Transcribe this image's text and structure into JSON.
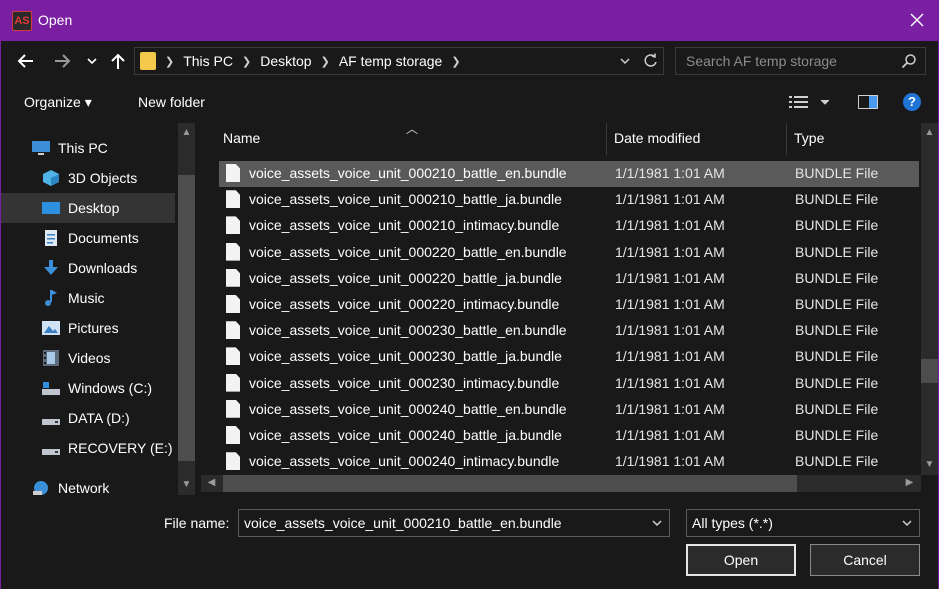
{
  "window": {
    "title": "Open",
    "app_icon_text": "AS"
  },
  "address": {
    "crumbs": [
      "This PC",
      "Desktop",
      "AF temp storage"
    ],
    "search_placeholder": "Search AF temp storage"
  },
  "toolbar": {
    "organize_label": "Organize ▾",
    "new_folder_label": "New folder"
  },
  "sidebar": {
    "items": [
      {
        "label": "This PC",
        "icon": "computer-icon"
      },
      {
        "label": "3D Objects",
        "icon": "cube-icon"
      },
      {
        "label": "Desktop",
        "icon": "desktop-icon"
      },
      {
        "label": "Documents",
        "icon": "document-icon"
      },
      {
        "label": "Downloads",
        "icon": "download-icon"
      },
      {
        "label": "Music",
        "icon": "music-icon"
      },
      {
        "label": "Pictures",
        "icon": "picture-icon"
      },
      {
        "label": "Videos",
        "icon": "video-icon"
      },
      {
        "label": "Windows (C:)",
        "icon": "drive-icon"
      },
      {
        "label": "DATA (D:)",
        "icon": "drive-icon"
      },
      {
        "label": "RECOVERY (E:)",
        "icon": "drive-icon"
      },
      {
        "label": "Network",
        "icon": "network-icon"
      }
    ],
    "selected": "Desktop"
  },
  "filelist": {
    "columns": [
      "Name",
      "Date modified",
      "Type"
    ],
    "rows": [
      {
        "name": "voice_assets_voice_unit_000210_battle_en.bundle",
        "date": "1/1/1981 1:01 AM",
        "type": "BUNDLE File"
      },
      {
        "name": "voice_assets_voice_unit_000210_battle_ja.bundle",
        "date": "1/1/1981 1:01 AM",
        "type": "BUNDLE File"
      },
      {
        "name": "voice_assets_voice_unit_000210_intimacy.bundle",
        "date": "1/1/1981 1:01 AM",
        "type": "BUNDLE File"
      },
      {
        "name": "voice_assets_voice_unit_000220_battle_en.bundle",
        "date": "1/1/1981 1:01 AM",
        "type": "BUNDLE File"
      },
      {
        "name": "voice_assets_voice_unit_000220_battle_ja.bundle",
        "date": "1/1/1981 1:01 AM",
        "type": "BUNDLE File"
      },
      {
        "name": "voice_assets_voice_unit_000220_intimacy.bundle",
        "date": "1/1/1981 1:01 AM",
        "type": "BUNDLE File"
      },
      {
        "name": "voice_assets_voice_unit_000230_battle_en.bundle",
        "date": "1/1/1981 1:01 AM",
        "type": "BUNDLE File"
      },
      {
        "name": "voice_assets_voice_unit_000230_battle_ja.bundle",
        "date": "1/1/1981 1:01 AM",
        "type": "BUNDLE File"
      },
      {
        "name": "voice_assets_voice_unit_000230_intimacy.bundle",
        "date": "1/1/1981 1:01 AM",
        "type": "BUNDLE File"
      },
      {
        "name": "voice_assets_voice_unit_000240_battle_en.bundle",
        "date": "1/1/1981 1:01 AM",
        "type": "BUNDLE File"
      },
      {
        "name": "voice_assets_voice_unit_000240_battle_ja.bundle",
        "date": "1/1/1981 1:01 AM",
        "type": "BUNDLE File"
      },
      {
        "name": "voice_assets_voice_unit_000240_intimacy.bundle",
        "date": "1/1/1981 1:01 AM",
        "type": "BUNDLE File"
      }
    ],
    "selected_index": 0
  },
  "footer": {
    "filename_label": "File name:",
    "filename_value": "voice_assets_voice_unit_000210_battle_en.bundle",
    "filetype_value": "All types (*.*)",
    "open_label": "Open",
    "cancel_label": "Cancel"
  },
  "colors": {
    "accent": "#7a1fa2",
    "background": "#191919",
    "selection": "#5a5a5a"
  }
}
